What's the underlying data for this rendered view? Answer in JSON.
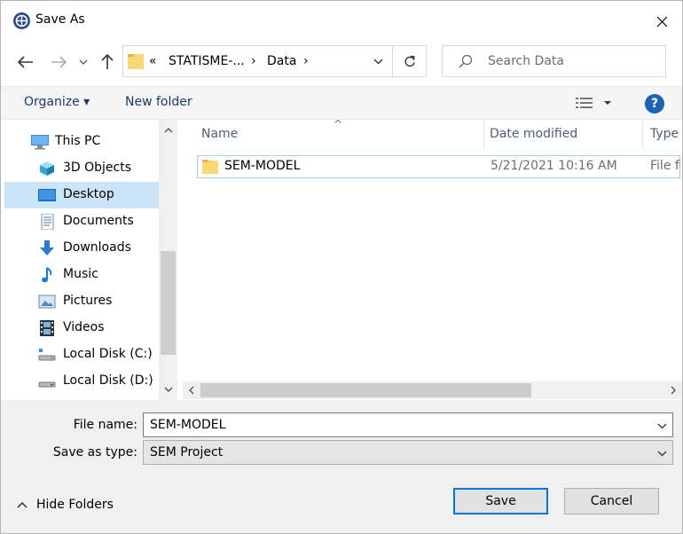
{
  "window": {
    "title": "Save As"
  },
  "nav": {
    "address": {
      "prefix": "«",
      "crumb1": "STATISME-...",
      "sep1": "›",
      "crumb2": "Data",
      "sep2": "›"
    },
    "search_placeholder": "Search Data"
  },
  "toolbar": {
    "organize": "Organize ▾",
    "new_folder": "New folder",
    "help": "?"
  },
  "sidebar": {
    "items": [
      {
        "label": "This PC",
        "icon": "pc-icon"
      },
      {
        "label": "3D Objects",
        "icon": "cube-icon"
      },
      {
        "label": "Desktop",
        "icon": "desktop-icon",
        "selected": true
      },
      {
        "label": "Documents",
        "icon": "document-icon"
      },
      {
        "label": "Downloads",
        "icon": "download-arrow-icon"
      },
      {
        "label": "Music",
        "icon": "music-note-icon"
      },
      {
        "label": "Pictures",
        "icon": "picture-icon"
      },
      {
        "label": "Videos",
        "icon": "film-icon"
      },
      {
        "label": "Local Disk (C:)",
        "icon": "drive-icon"
      },
      {
        "label": "Local Disk (D:)",
        "icon": "drive-icon"
      }
    ]
  },
  "files": {
    "columns": [
      "Name",
      "Date modified",
      "Type"
    ],
    "rows": [
      {
        "name": "SEM-MODEL",
        "date": "5/21/2021 10:16 AM",
        "type": "File folder"
      }
    ]
  },
  "form": {
    "file_name_label": "File name:",
    "file_name_value": "SEM-MODEL",
    "save_type_label": "Save as type:",
    "save_type_value": "SEM Project"
  },
  "footer": {
    "hide_folders": "Hide Folders",
    "save": "Save",
    "cancel": "Cancel"
  },
  "colors": {
    "accent": "#0078d7",
    "selection": "#cce4f7",
    "folder": "#f8d775",
    "link": "#1a3a6a"
  }
}
